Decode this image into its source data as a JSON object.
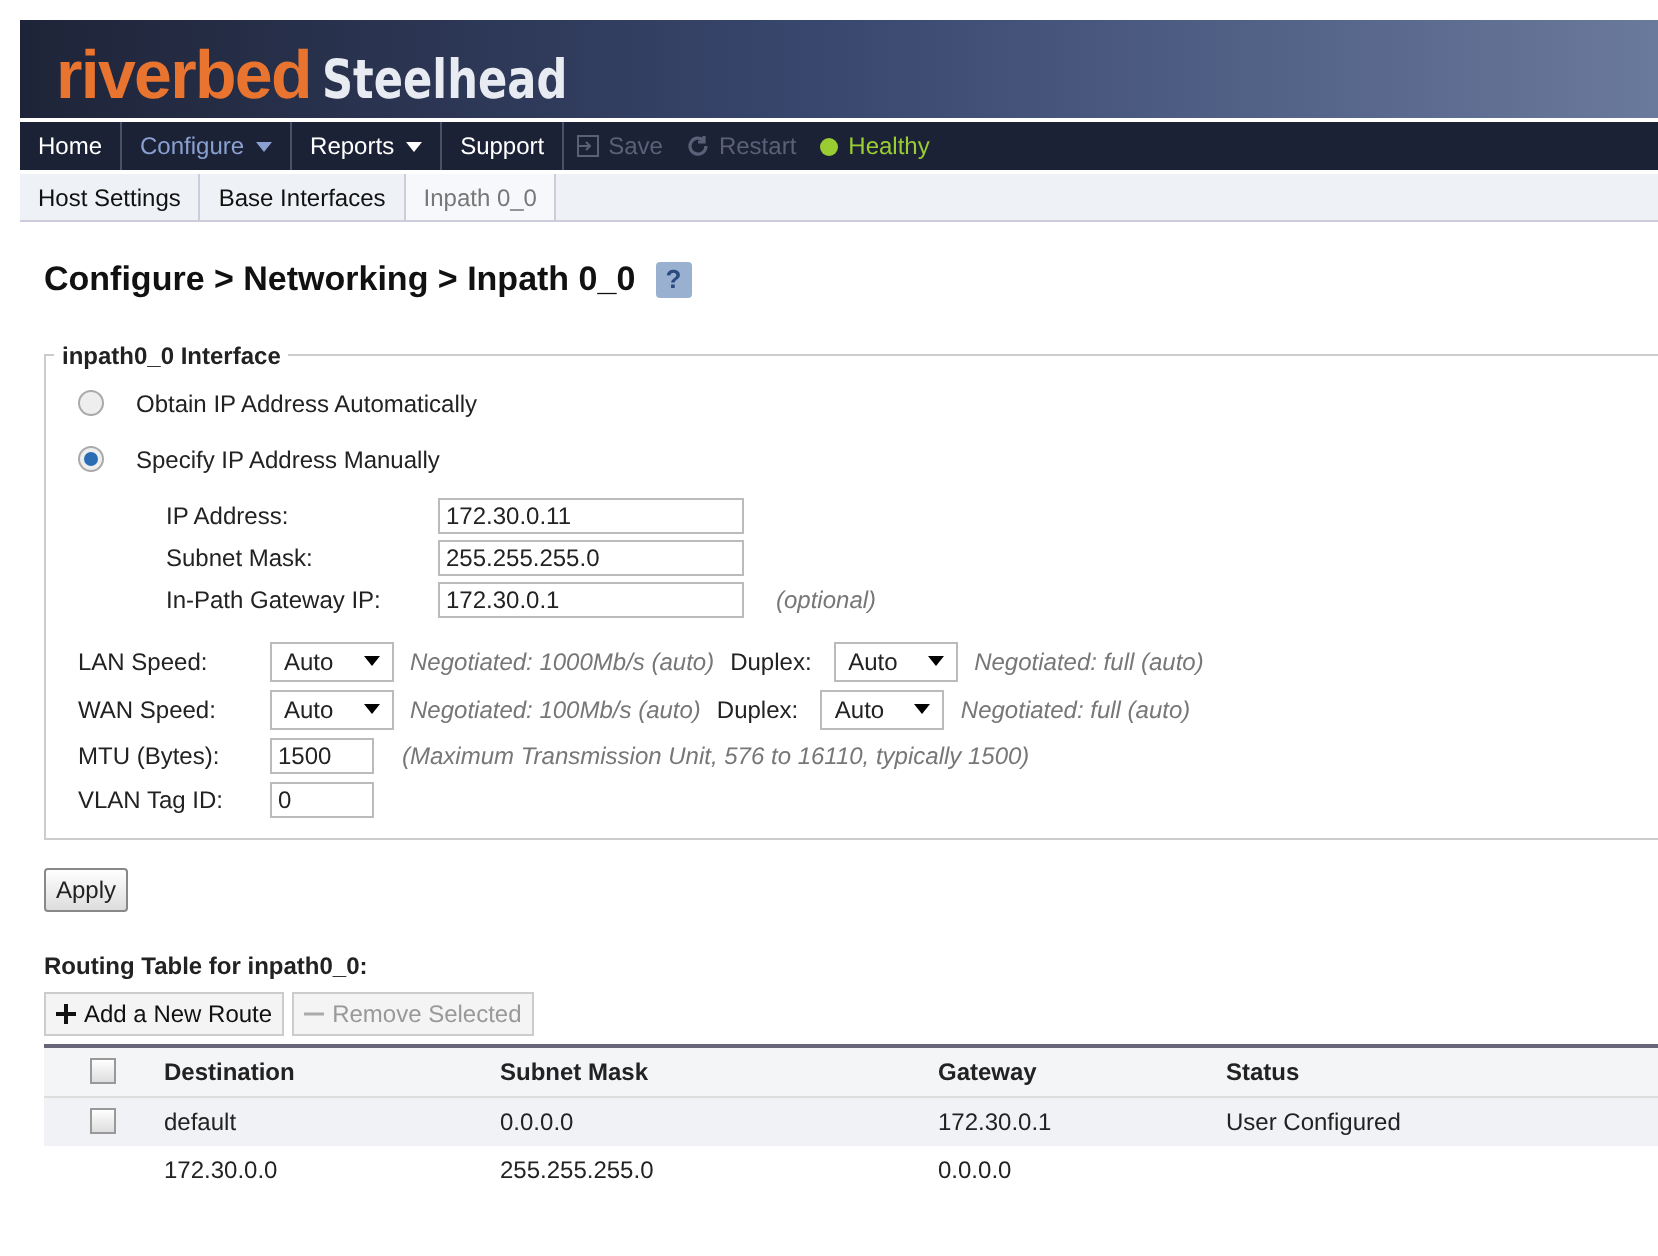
{
  "logo": {
    "brand": "riverbed",
    "product": "Steelhead"
  },
  "nav": [
    {
      "label": "Home",
      "kind": "link",
      "selected": false
    },
    {
      "label": "Configure",
      "kind": "menu",
      "selected": true
    },
    {
      "label": "Reports",
      "kind": "menu",
      "selected": false
    },
    {
      "label": "Support",
      "kind": "link",
      "selected": false
    }
  ],
  "actions": [
    {
      "label": "Save",
      "kind": "save",
      "disabled": true
    },
    {
      "label": "Restart",
      "kind": "restart",
      "disabled": true
    }
  ],
  "status": {
    "label": "Healthy",
    "color": "#9acd32"
  },
  "subtabs": [
    {
      "label": "Host Settings",
      "selected": false
    },
    {
      "label": "Base Interfaces",
      "selected": false
    },
    {
      "label": "Inpath 0_0",
      "selected": true
    }
  ],
  "page_title": "Configure > Networking > Inpath 0_0",
  "help": "?",
  "fieldset": {
    "legend": "inpath0_0 Interface",
    "radios": [
      {
        "label": "Obtain IP Address Automatically",
        "selected": false
      },
      {
        "label": "Specify IP Address Manually",
        "selected": true
      }
    ],
    "fields": [
      {
        "label": "IP Address:",
        "value": "172.30.0.11"
      },
      {
        "label": "Subnet Mask:",
        "value": "255.255.255.0"
      },
      {
        "label": "In-Path Gateway IP:",
        "value": "172.30.0.1",
        "note": "(optional)"
      }
    ],
    "speeds": [
      {
        "label": "LAN Speed:",
        "value": "Auto",
        "negotiated": "Negotiated: 1000Mb/s (auto)",
        "duplex_label": "Duplex:",
        "duplex": "Auto",
        "duplex_negotiated": "Negotiated: full (auto)"
      },
      {
        "label": "WAN Speed:",
        "value": "Auto",
        "negotiated": "Negotiated: 100Mb/s (auto)",
        "duplex_label": "Duplex:",
        "duplex": "Auto",
        "duplex_negotiated": "Negotiated: full (auto)"
      }
    ],
    "small_fields": [
      {
        "label": "MTU (Bytes):",
        "value": "1500",
        "note": "(Maximum Transmission Unit, 576 to 16110, typically 1500)"
      },
      {
        "label": "VLAN Tag ID:",
        "value": "0"
      }
    ]
  },
  "apply": "Apply",
  "routing": {
    "title": "Routing Table for inpath0_0:",
    "buttons": [
      {
        "label": "Add a New Route",
        "kind": "add",
        "disabled": false
      },
      {
        "label": "Remove Selected",
        "kind": "remove",
        "disabled": true
      }
    ],
    "columns": [
      "Destination",
      "Subnet Mask",
      "Gateway",
      "Status"
    ],
    "header_checked": false,
    "rows": [
      {
        "kind": "checkbox",
        "checked": false,
        "cells": [
          "default",
          "0.0.0.0",
          "172.30.0.1",
          "User Configured"
        ]
      },
      {
        "kind": "plain",
        "cells": [
          "172.30.0.0",
          "255.255.255.0",
          "0.0.0.0",
          ""
        ]
      }
    ]
  }
}
